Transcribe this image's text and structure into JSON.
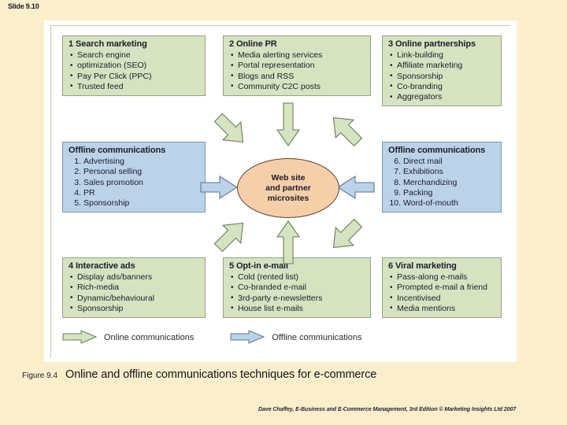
{
  "slide": {
    "number_label": "Slide 9.10"
  },
  "figure": {
    "caption_number": "Figure 9.4",
    "caption_title": "Online and offline communications techniques for e-commerce",
    "center_node": {
      "line1": "Web site",
      "line2": "and partner",
      "line3": "microsites"
    },
    "boxes": [
      {
        "id": "box-search",
        "kind": "online",
        "title": "1 Search marketing",
        "list_type": "bullet",
        "items": [
          "Search engine",
          "optimization (SEO)",
          "Pay Per Click (PPC)",
          "Trusted feed"
        ],
        "wrapped_continuations": [
          1
        ]
      },
      {
        "id": "box-pr",
        "kind": "online",
        "title": "2 Online PR",
        "list_type": "bullet",
        "items": [
          "Media alerting services",
          "Portal representation",
          "Blogs and RSS",
          "Community C2C posts"
        ]
      },
      {
        "id": "box-partner",
        "kind": "online",
        "title": "3 Online partnerships",
        "list_type": "bullet",
        "items": [
          "Link-building",
          "Affiliate marketing",
          "Sponsorship",
          "Co-branding",
          "Aggregators"
        ]
      },
      {
        "id": "box-offline1",
        "kind": "offline",
        "title": "Offline communications",
        "list_type": "number",
        "numbers": [
          "1.",
          "2.",
          "3.",
          "4.",
          "5."
        ],
        "items": [
          "Advertising",
          "Personal selling",
          "Sales promotion",
          "PR",
          "Sponsorship"
        ]
      },
      {
        "id": "box-offline2",
        "kind": "offline",
        "title": "Offline communications",
        "list_type": "number",
        "numbers": [
          "6.",
          "7.",
          "8.",
          "9.",
          "10."
        ],
        "items": [
          "Direct mail",
          "Exhibitions",
          "Merchandizing",
          "Packing",
          "Word-of-mouth"
        ]
      },
      {
        "id": "box-ads",
        "kind": "online",
        "title": "4 Interactive ads",
        "list_type": "bullet",
        "items": [
          "Display ads/banners",
          "Rich-media",
          "Dynamic/behavioural",
          "Sponsorship"
        ]
      },
      {
        "id": "box-optin",
        "kind": "online",
        "title": "5 Opt-in e-mail",
        "list_type": "bullet",
        "items": [
          "Cold (rented list)",
          "Co-branded e-mail",
          "3rd-party e-newsletters",
          "House list e-mails"
        ]
      },
      {
        "id": "box-viral",
        "kind": "online",
        "title": "6 Viral marketing",
        "list_type": "bullet",
        "items": [
          "Pass-along e-mails",
          "Prompted e-mail a friend",
          "Incentivised",
          "Media mentions"
        ]
      }
    ],
    "legend": [
      {
        "key": "online",
        "label": "Online communications",
        "color": "#d6e3c1"
      },
      {
        "key": "offline",
        "label": "Offline communications",
        "color": "#bbd2e8"
      }
    ],
    "arrows": [
      {
        "name": "arrow-search-to-center",
        "kind": "online",
        "direction": "down-right"
      },
      {
        "name": "arrow-pr-to-center",
        "kind": "online",
        "direction": "down"
      },
      {
        "name": "arrow-partnerships-to-center",
        "kind": "online",
        "direction": "down-left"
      },
      {
        "name": "arrow-offline1-to-center",
        "kind": "offline",
        "direction": "right"
      },
      {
        "name": "arrow-offline2-to-center",
        "kind": "offline",
        "direction": "left"
      },
      {
        "name": "arrow-ads-to-center",
        "kind": "online",
        "direction": "up-right"
      },
      {
        "name": "arrow-optin-to-center",
        "kind": "online",
        "direction": "up"
      },
      {
        "name": "arrow-viral-to-center",
        "kind": "online",
        "direction": "up-left"
      }
    ]
  },
  "footer": {
    "credit": "Dave Chaffey, E-Business and E-Commerce Management, 3rd Edition © Marketing Insights Ltd 2007"
  },
  "colors": {
    "background": "#faeecb",
    "panel": "#ffffff",
    "online_fill": "#d6e3c1",
    "online_stroke": "#97a383",
    "offline_fill": "#bbd2e8",
    "offline_stroke": "#7f94ac",
    "center_fill": "#f5cfa8",
    "center_stroke": "#5a4434"
  }
}
